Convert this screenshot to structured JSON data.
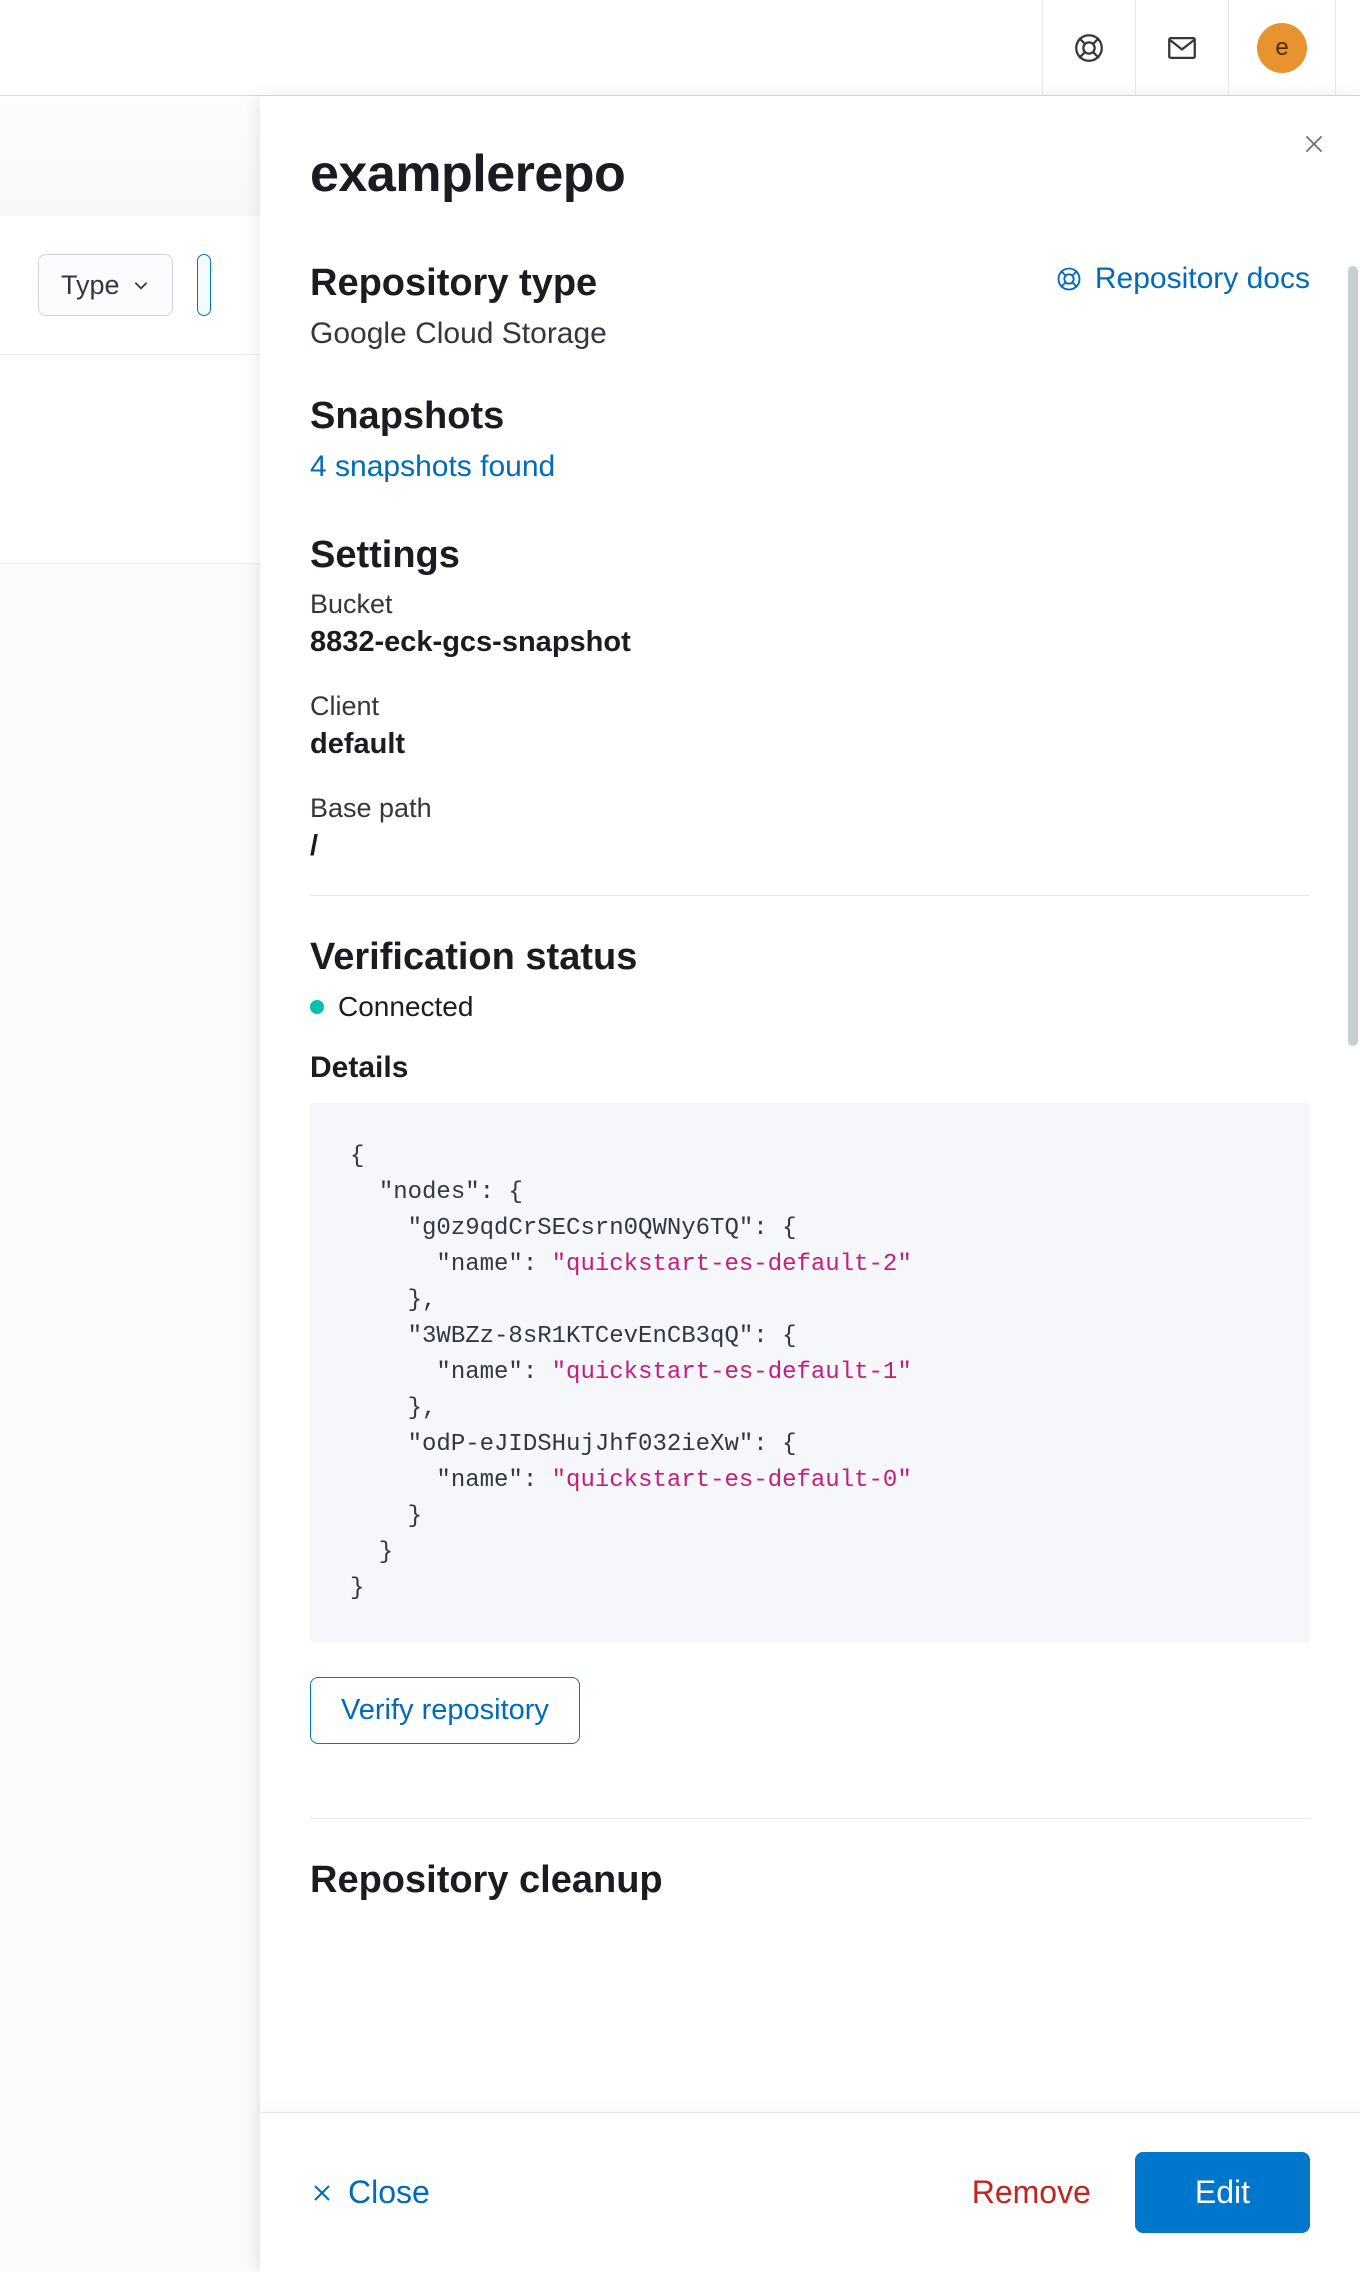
{
  "header": {
    "avatar_initial": "e"
  },
  "background": {
    "type_filter_label": "Type"
  },
  "flyout": {
    "repo_name": "examplerepo",
    "docs_link": "Repository docs",
    "sections": {
      "repo_type": {
        "heading": "Repository type",
        "value": "Google Cloud Storage"
      },
      "snapshots": {
        "heading": "Snapshots",
        "link": "4 snapshots found"
      },
      "settings": {
        "heading": "Settings",
        "bucket_label": "Bucket",
        "bucket_value": "8832-eck-gcs-snapshot",
        "client_label": "Client",
        "client_value": "default",
        "basepath_label": "Base path",
        "basepath_value": "/"
      },
      "verification": {
        "heading": "Verification status",
        "status_text": "Connected",
        "details_heading": "Details",
        "code_nodes": [
          {
            "id": "g0z9qdCrSECsrn0QWNy6TQ",
            "name": "quickstart-es-default-2"
          },
          {
            "id": "3WBZz-8sR1KTCevEnCB3qQ",
            "name": "quickstart-es-default-1"
          },
          {
            "id": "odP-eJIDSHujJhf032ieXw",
            "name": "quickstart-es-default-0"
          }
        ],
        "verify_button": "Verify repository"
      },
      "cleanup": {
        "heading": "Repository cleanup"
      }
    },
    "footer": {
      "close": "Close",
      "remove": "Remove",
      "edit": "Edit"
    }
  }
}
